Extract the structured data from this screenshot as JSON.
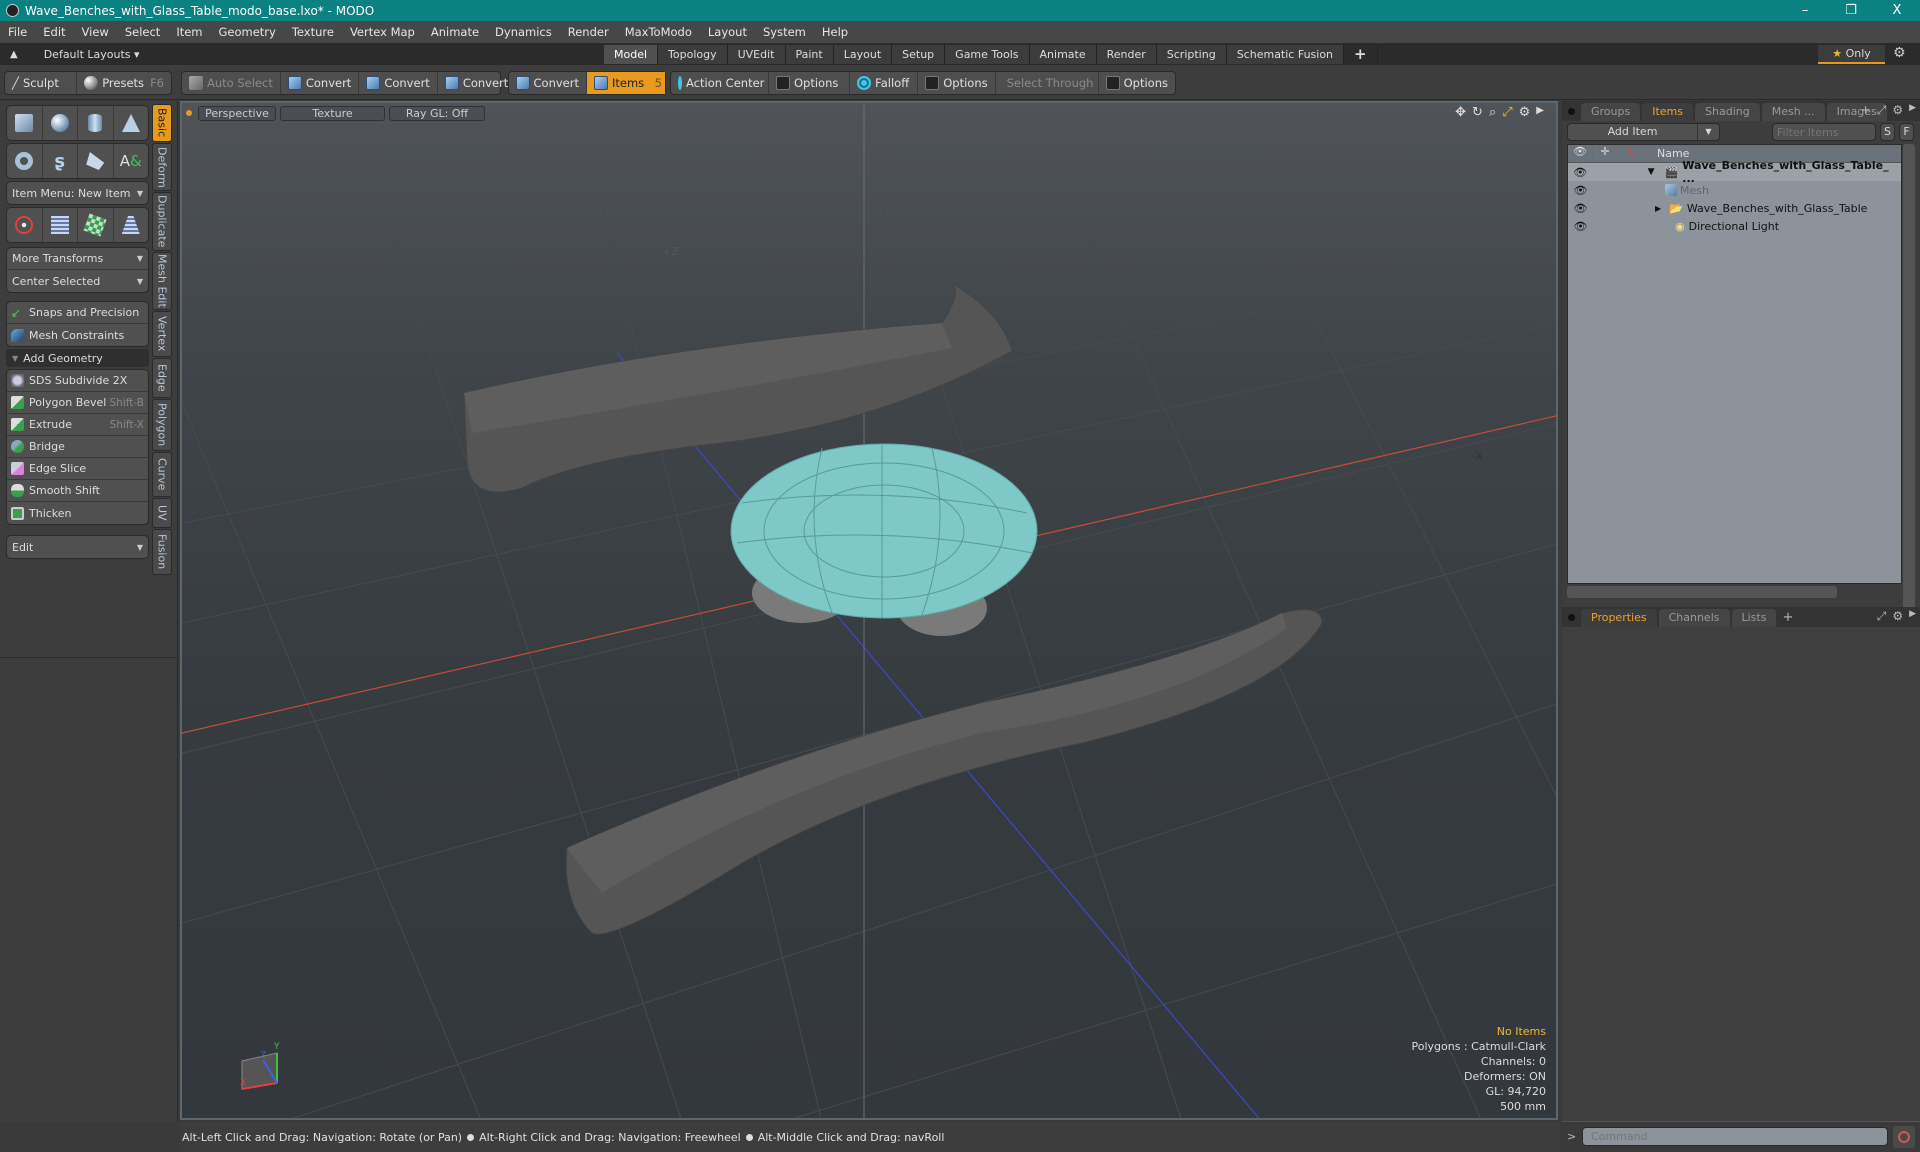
{
  "window": {
    "title": "Wave_Benches_with_Glass_Table_modo_base.lxo* - MODO",
    "minimize": "–",
    "restore": "❐",
    "close": "X"
  },
  "menu": [
    "File",
    "Edit",
    "View",
    "Select",
    "Item",
    "Geometry",
    "Texture",
    "Vertex Map",
    "Animate",
    "Dynamics",
    "Render",
    "MaxToModo",
    "Layout",
    "System",
    "Help"
  ],
  "layout_bar": {
    "layouts_label": "Default Layouts ▾",
    "tabs": [
      {
        "label": "Model",
        "active": true
      },
      {
        "label": "Topology"
      },
      {
        "label": "UVEdit"
      },
      {
        "label": "Paint"
      },
      {
        "label": "Layout"
      },
      {
        "label": "Setup"
      },
      {
        "label": "Game Tools"
      },
      {
        "label": "Animate"
      },
      {
        "label": "Render"
      },
      {
        "label": "Scripting"
      },
      {
        "label": "Schematic Fusion"
      }
    ],
    "add_tab": "+",
    "only_label": "Only",
    "star": "★"
  },
  "toolbar": {
    "sculpt": "Sculpt",
    "presets": "Presets",
    "presets_key": "F6",
    "auto_select": "Auto Select",
    "convert": "Convert",
    "items": "Items",
    "items_count": "5",
    "action_center": "Action Center",
    "options": "Options",
    "falloff": "Falloff",
    "select_through": "Select Through"
  },
  "left_panel": {
    "item_menu": "Item Menu: New Item",
    "more_transforms": "More Transforms",
    "center_selected": "Center Selected",
    "snaps": "Snaps and Precision",
    "mesh_constraints": "Mesh Constraints",
    "add_geometry": "Add Geometry",
    "tools": [
      {
        "label": "SDS Subdivide 2X",
        "shortcut": ""
      },
      {
        "label": "Polygon Bevel",
        "shortcut": "Shift-B"
      },
      {
        "label": "Extrude",
        "shortcut": "Shift-X"
      },
      {
        "label": "Bridge",
        "shortcut": ""
      },
      {
        "label": "Edge Slice",
        "shortcut": ""
      },
      {
        "label": "Smooth Shift",
        "shortcut": ""
      },
      {
        "label": "Thicken",
        "shortcut": ""
      }
    ],
    "edit_dropdown": "Edit",
    "vertical_tabs": [
      "Basic",
      "Deform",
      "Duplicate",
      "Mesh Edit",
      "Vertex",
      "Edge",
      "Polygon",
      "Curve",
      "UV",
      "Fusion"
    ]
  },
  "viewport": {
    "view_mode": "Perspective",
    "shading": "Texture",
    "raygl": "Ray GL: Off",
    "axis_labels": {
      "z": "+Z",
      "x": "-X"
    },
    "gizmo": {
      "x": "X",
      "y": "Y",
      "z": "Z"
    },
    "info": {
      "selection": "No Items",
      "polygons": "Polygons : Catmull-Clark",
      "channels": "Channels: 0",
      "deformers": "Deformers: ON",
      "gl": "GL: 94,720",
      "grid": "500 mm"
    },
    "colors": {
      "table_top": "#7ec8c8",
      "x_axis": "#c84a3a",
      "z_axis": "#3a4ac8",
      "bench": "#5a5a5a"
    }
  },
  "items_panel": {
    "tabs": [
      {
        "label": "Groups"
      },
      {
        "label": "Items",
        "active": true
      },
      {
        "label": "Shading"
      },
      {
        "label": "Mesh ..."
      },
      {
        "label": "Images"
      }
    ],
    "add_item": "Add Item",
    "filter_placeholder": "Filter Items",
    "s_btn": "S",
    "f_btn": "F",
    "name_header": "Name",
    "tree": [
      {
        "label": "Wave_Benches_with_Glass_Table_ ...",
        "kind": "scene",
        "bold": true
      },
      {
        "label": "Mesh",
        "kind": "mesh",
        "dim": true
      },
      {
        "label": "Wave_Benches_with_Glass_Table",
        "kind": "group"
      },
      {
        "label": "Directional Light",
        "kind": "light"
      }
    ]
  },
  "properties_panel": {
    "tabs": [
      {
        "label": "Properties",
        "active": true
      },
      {
        "label": "Channels"
      },
      {
        "label": "Lists"
      }
    ],
    "add": "+"
  },
  "command": {
    "prompt": ">",
    "placeholder": "Command"
  },
  "status": {
    "hints": [
      "Alt-Left Click and Drag: Navigation: Rotate (or Pan)",
      "Alt-Right Click and Drag: Navigation: Freewheel",
      "Alt-Middle Click and Drag: navRoll"
    ]
  }
}
